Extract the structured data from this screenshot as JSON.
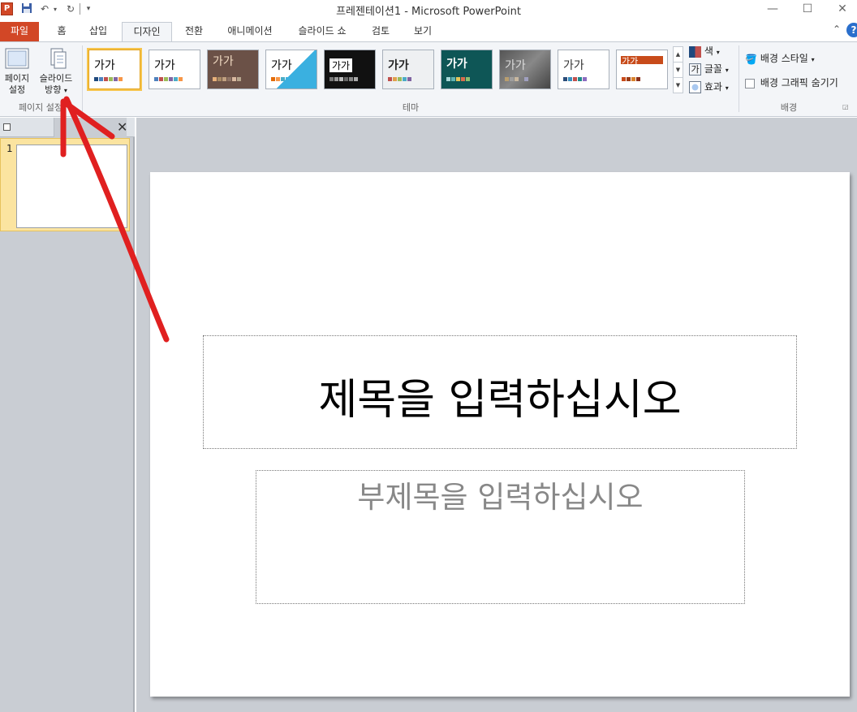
{
  "app": {
    "icon_letter": "P",
    "window_title": "프레젠테이션1  -  Microsoft PowerPoint"
  },
  "tabs": [
    {
      "label": "파일"
    },
    {
      "label": "홈"
    },
    {
      "label": "삽입"
    },
    {
      "label": "디자인"
    },
    {
      "label": "전환"
    },
    {
      "label": "애니메이션"
    },
    {
      "label": "슬라이드 쇼"
    },
    {
      "label": "검토"
    },
    {
      "label": "보기"
    }
  ],
  "active_tab": "디자인",
  "ribbon": {
    "page_setup": {
      "page_setup_label_1": "페이지",
      "page_setup_label_2": "설정",
      "orientation_label_1": "슬라이드",
      "orientation_label_2": "방향",
      "group_label": "페이지 설정"
    },
    "themes": {
      "group_label": "테마",
      "thumb_text": "가가",
      "colors_label": "색",
      "fonts_label": "글꼴",
      "effects_label": "효과"
    },
    "background": {
      "group_label": "배경",
      "styles_label": "배경 스타일",
      "hide_graphics_label": "배경 그래픽 숨기기"
    }
  },
  "thumbnails": {
    "slide_number": "1"
  },
  "slide": {
    "title_placeholder": "제목을 입력하십시오",
    "subtitle_placeholder": "부제목을 입력하십시오"
  },
  "colors": {
    "file_tab": "#d24726",
    "annotation_arrow": "#e02020",
    "selection": "#f6c54e"
  }
}
